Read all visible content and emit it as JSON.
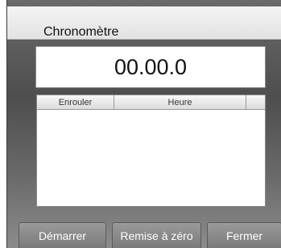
{
  "window": {
    "title": "Chronomètre"
  },
  "display": {
    "time": "00.00.0"
  },
  "lap_table": {
    "columns": [
      "Enrouler",
      "Heure"
    ],
    "rows": []
  },
  "buttons": {
    "start": "Démarrer",
    "reset": "Remise à zéro",
    "close": "Fermer"
  }
}
